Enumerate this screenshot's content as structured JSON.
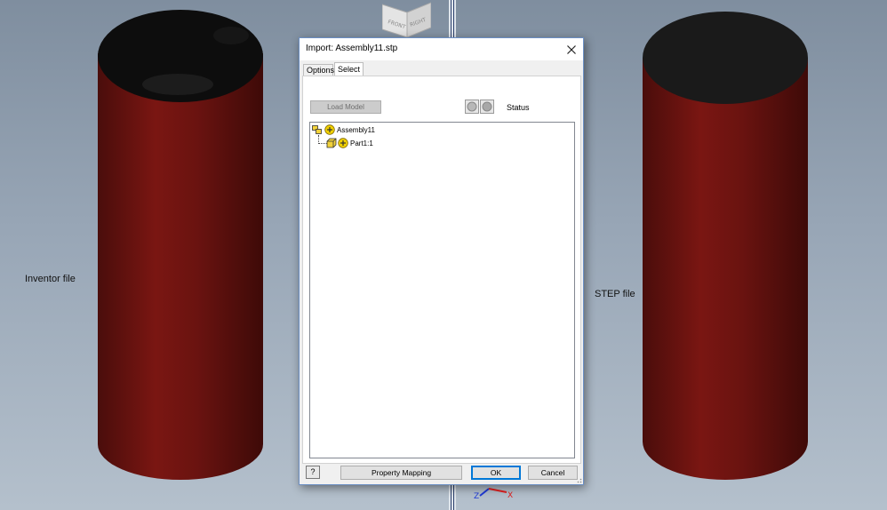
{
  "viewport_left": {
    "label": "Inventor file"
  },
  "viewport_right": {
    "label": "STEP file"
  },
  "viewcube": {
    "faces": [
      "FRONT",
      "RIGHT"
    ]
  },
  "triad": {
    "axes": [
      "Z",
      "X"
    ]
  },
  "colors": {
    "cylinder_body": "#6b1310",
    "cylinder_top": "#1a1a1a",
    "accent": "#0078d7"
  },
  "dialog": {
    "title": "Import:  Assembly11.stp",
    "close_icon": "close-icon",
    "tabs": [
      {
        "label": "Options",
        "active": false
      },
      {
        "label": "Select",
        "active": true
      }
    ],
    "load_model_label": "Load Model",
    "status_label": "Status",
    "tree": [
      {
        "label": "Assembly11",
        "icon": "assembly-icon"
      },
      {
        "label": "Part1:1",
        "icon": "part-icon"
      }
    ],
    "help_label": "?",
    "property_mapping_label": "Property Mapping",
    "ok_label": "OK",
    "cancel_label": "Cancel"
  }
}
